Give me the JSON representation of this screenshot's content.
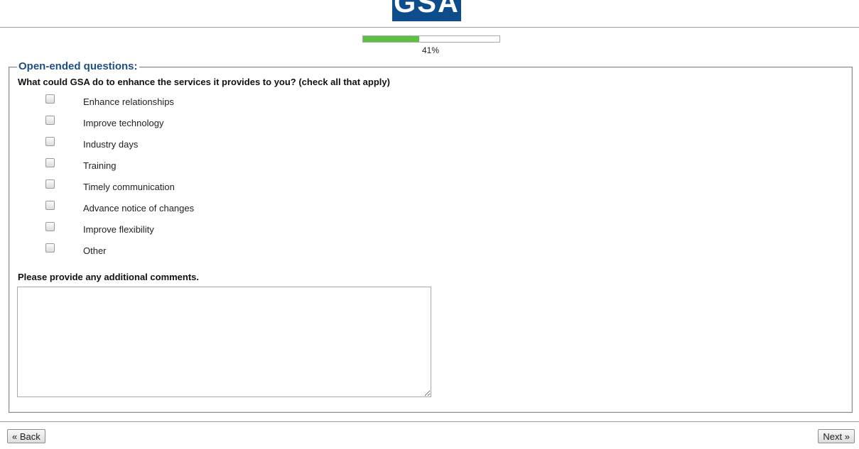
{
  "header": {
    "logo_text": "GSA"
  },
  "progress": {
    "fraction": 0.41,
    "label": "41%"
  },
  "section": {
    "legend": "Open-ended questions:",
    "question": "What could GSA do to enhance the services it provides to you? (check all that apply)",
    "options": [
      {
        "label": "Enhance relationships",
        "checked": false
      },
      {
        "label": "Improve technology",
        "checked": false
      },
      {
        "label": "Industry days",
        "checked": false
      },
      {
        "label": "Training",
        "checked": false
      },
      {
        "label": "Timely communication",
        "checked": false
      },
      {
        "label": "Advance notice of changes",
        "checked": false
      },
      {
        "label": "Improve flexibility",
        "checked": false
      },
      {
        "label": "Other",
        "checked": false
      }
    ],
    "comments_label": "Please provide any additional comments.",
    "comments_value": ""
  },
  "nav": {
    "back_label": "« Back",
    "next_label": "Next »"
  }
}
